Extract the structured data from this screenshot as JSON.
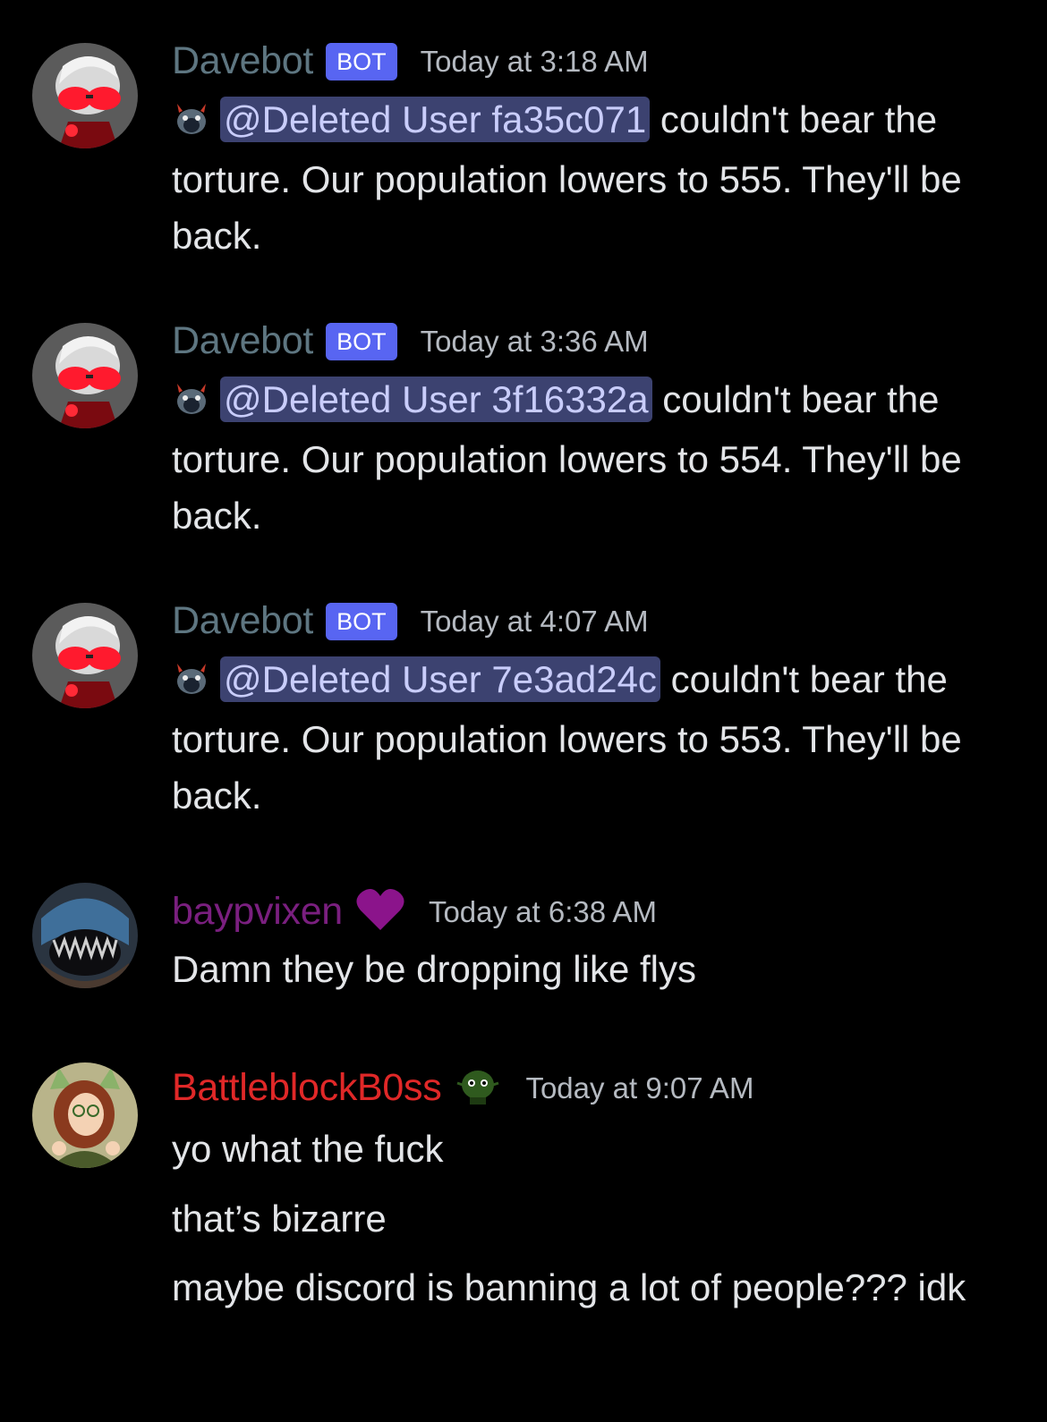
{
  "colors": {
    "background": "#000000",
    "bot_name": "#5e7681",
    "bot_tag": "#5865f2",
    "mention_bg": "#3c4270",
    "baypvixen_name": "#7a1f7f",
    "heart": "#8b148b",
    "battleblock_name": "#e02828",
    "timestamp": "#b5bac1"
  },
  "messages": [
    {
      "username": "Davebot",
      "tag": "BOT",
      "timestamp": "Today at 3:18 AM",
      "mention": "@Deleted User fa35c071",
      "text_after": " couldn't bear the torture. Our population lowers to 555. They'll be back.",
      "avatar_icon": "davebot-avatar"
    },
    {
      "username": "Davebot",
      "tag": "BOT",
      "timestamp": "Today at 3:36 AM",
      "mention": "@Deleted User 3f16332a",
      "text_after": " couldn't bear the torture. Our population lowers to 554. They'll be back.",
      "avatar_icon": "davebot-avatar"
    },
    {
      "username": "Davebot",
      "tag": "BOT",
      "timestamp": "Today at 4:07 AM",
      "mention": "@Deleted User 7e3ad24c",
      "text_after": " couldn't bear the torture. Our population lowers to 553. They'll be back.",
      "avatar_icon": "davebot-avatar"
    },
    {
      "username": "baypvixen",
      "timestamp": "Today at 6:38 AM",
      "role_icon": "heart-icon",
      "lines": [
        "Damn they be dropping like flys"
      ],
      "avatar_icon": "creature-avatar"
    },
    {
      "username": "BattleblockB0ss",
      "timestamp": "Today at 9:07 AM",
      "role_icon": "green-head-icon",
      "lines": [
        "yo what the fuck",
        "that’s bizarre",
        "maybe discord is banning a lot of people??? idk"
      ],
      "avatar_icon": "anime-avatar"
    }
  ]
}
